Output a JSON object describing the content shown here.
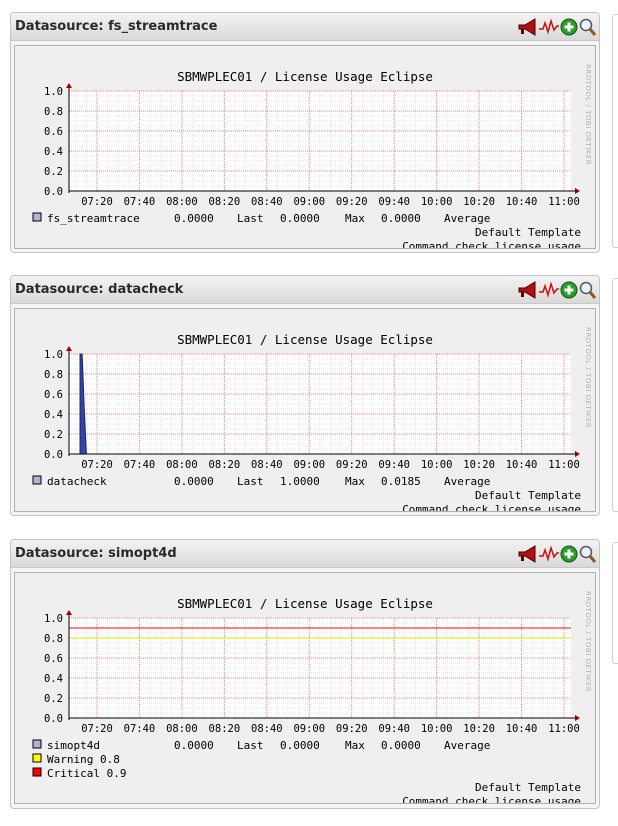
{
  "page": {
    "panels": [
      {
        "header": "Datasource: fs_streamtrace",
        "graph_title": "SBMWPLEC01 / License Usage Eclipse",
        "watermark": "RRDTOOL / TOBI OETIKER",
        "legend": [
          {
            "label": "fs_streamtrace",
            "last": "0.0000",
            "max": "0.0000",
            "average": "Average",
            "color": "#b0b4d8"
          }
        ],
        "template_line": "Default Template",
        "command_line": "Command check_license_usage"
      },
      {
        "header": "Datasource: datacheck",
        "graph_title": "SBMWPLEC01 / License Usage Eclipse",
        "watermark": "RRDTOOL / TOBI OETIKER",
        "legend": [
          {
            "label": "datacheck",
            "last": "0.0000",
            "max": "1.0000",
            "average": "0.0185 Average",
            "color": "#b0b4d8"
          }
        ],
        "template_line": "Default Template",
        "command_line": "Command check_license_usage"
      },
      {
        "header": "Datasource: simopt4d",
        "graph_title": "SBMWPLEC01 / License Usage Eclipse",
        "watermark": "RRDTOOL / TOBI OETIKER",
        "legend": [
          {
            "label": "simopt4d",
            "last": "0.0000",
            "max": "0.0000",
            "average": "Average",
            "color": "#b0b4d8"
          }
        ],
        "extra_legend": [
          {
            "label": "Warning  0.8",
            "color": "#ffff00"
          },
          {
            "label": "Critical 0.9",
            "color": "#ff0000"
          }
        ],
        "template_line": "Default Template",
        "command_line": "Command check_license_usage"
      }
    ],
    "labels": {
      "last": "Last",
      "max": "Max"
    },
    "icon_names": [
      "megaphone-icon",
      "graph-line-icon",
      "add-icon",
      "zoom-icon"
    ]
  },
  "chart_data": [
    {
      "type": "area",
      "title": "SBMWPLEC01 / License Usage Eclipse",
      "x_ticks": [
        "07:20",
        "07:40",
        "08:00",
        "08:20",
        "08:40",
        "09:00",
        "09:20",
        "09:40",
        "10:00",
        "10:20",
        "10:40",
        "11:00"
      ],
      "y_ticks": [
        "0.0",
        "0.2",
        "0.4",
        "0.6",
        "0.8",
        "1.0"
      ],
      "ylim": [
        0,
        1
      ],
      "grid": true,
      "series": [
        {
          "name": "fs_streamtrace",
          "values": [
            0,
            0,
            0,
            0,
            0,
            0,
            0,
            0,
            0,
            0,
            0,
            0
          ],
          "color": "#b0b4d8"
        }
      ]
    },
    {
      "type": "area",
      "title": "SBMWPLEC01 / License Usage Eclipse",
      "x_ticks": [
        "07:20",
        "07:40",
        "08:00",
        "08:20",
        "08:40",
        "09:00",
        "09:20",
        "09:40",
        "10:00",
        "10:20",
        "10:40",
        "11:00"
      ],
      "y_ticks": [
        "0.0",
        "0.2",
        "0.4",
        "0.6",
        "0.8",
        "1.0"
      ],
      "ylim": [
        0,
        1
      ],
      "grid": true,
      "series": [
        {
          "name": "datacheck",
          "x": [
            "07:12",
            "07:13",
            "07:14",
            "07:15"
          ],
          "values": [
            1.0,
            1.0,
            0.45,
            0.0
          ],
          "color": "#2c3e99"
        }
      ]
    },
    {
      "type": "line",
      "title": "SBMWPLEC01 / License Usage Eclipse",
      "x_ticks": [
        "07:20",
        "07:40",
        "08:00",
        "08:20",
        "08:40",
        "09:00",
        "09:20",
        "09:40",
        "10:00",
        "10:20",
        "10:40",
        "11:00"
      ],
      "y_ticks": [
        "0.0",
        "0.2",
        "0.4",
        "0.6",
        "0.8",
        "1.0"
      ],
      "ylim": [
        0,
        1
      ],
      "grid": true,
      "series": [
        {
          "name": "simopt4d",
          "values": [
            0,
            0,
            0,
            0,
            0,
            0,
            0,
            0,
            0,
            0,
            0,
            0
          ],
          "color": "#b0b4d8"
        },
        {
          "name": "Warning",
          "values": [
            0.8,
            0.8,
            0.8,
            0.8,
            0.8,
            0.8,
            0.8,
            0.8,
            0.8,
            0.8,
            0.8,
            0.8
          ],
          "color": "#ffff00"
        },
        {
          "name": "Critical",
          "values": [
            0.9,
            0.9,
            0.9,
            0.9,
            0.9,
            0.9,
            0.9,
            0.9,
            0.9,
            0.9,
            0.9,
            0.9
          ],
          "color": "#ff0000"
        }
      ]
    }
  ]
}
